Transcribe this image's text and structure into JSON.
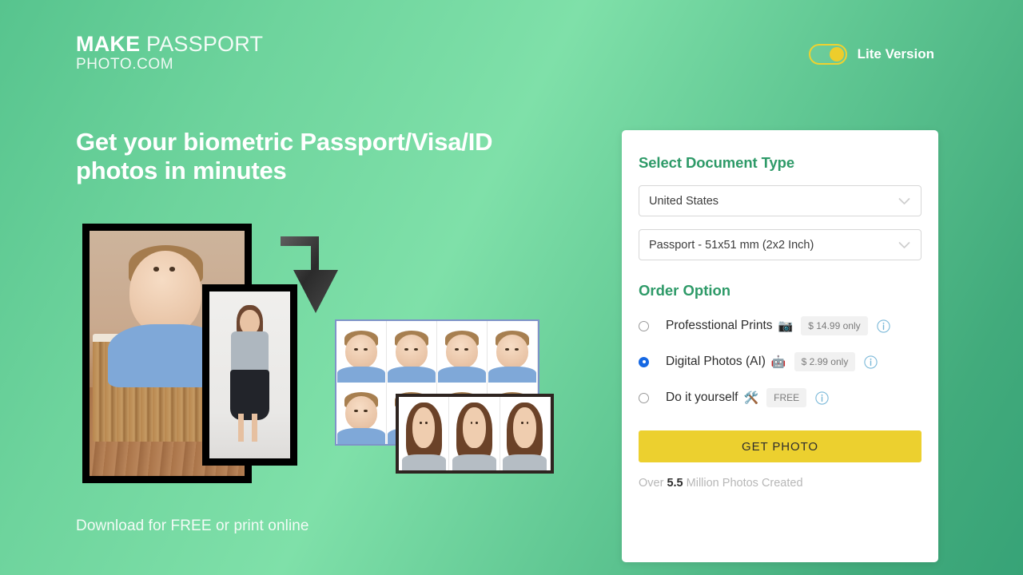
{
  "header": {
    "logo_make": "MAKE",
    "logo_passport": " PASSPORT",
    "logo_domain": "PHOTO.COM",
    "lite_label": "Lite Version",
    "toggle_state": "on"
  },
  "hero": {
    "headline": "Get your biometric Passport/Visa/ID photos in minutes",
    "subline": "Download for FREE or print online"
  },
  "card": {
    "document_type_title": "Select Document Type",
    "country_value": "United States",
    "document_value": "Passport - 51x51 mm (2x2 Inch)",
    "order_option_title": "Order Option",
    "options": [
      {
        "label": "Professtional Prints",
        "emoji": "📷",
        "emoji_name": "camera-icon",
        "price": "$ 14.99 only",
        "selected": false
      },
      {
        "label": "Digital Photos (AI)",
        "emoji": "🤖",
        "emoji_name": "robot-icon",
        "price": "$ 2.99 only",
        "selected": true
      },
      {
        "label": "Do it yourself",
        "emoji": "🛠️",
        "emoji_name": "hammer-and-wrench-icon",
        "price": "FREE",
        "selected": false
      }
    ],
    "cta_label": "GET PHOTO",
    "counter_prefix": "Over ",
    "counter_number": "5.5",
    "counter_suffix": " Million Photos Created"
  },
  "colors": {
    "brand_green": "#2e9a68",
    "accent_yellow": "#ecd02f",
    "bg_gradient_light": "#7fe0a9",
    "bg_gradient_dark": "#37a377",
    "radio_selected_blue": "#1668e3",
    "info_icon_blue": "#79b8d8"
  }
}
